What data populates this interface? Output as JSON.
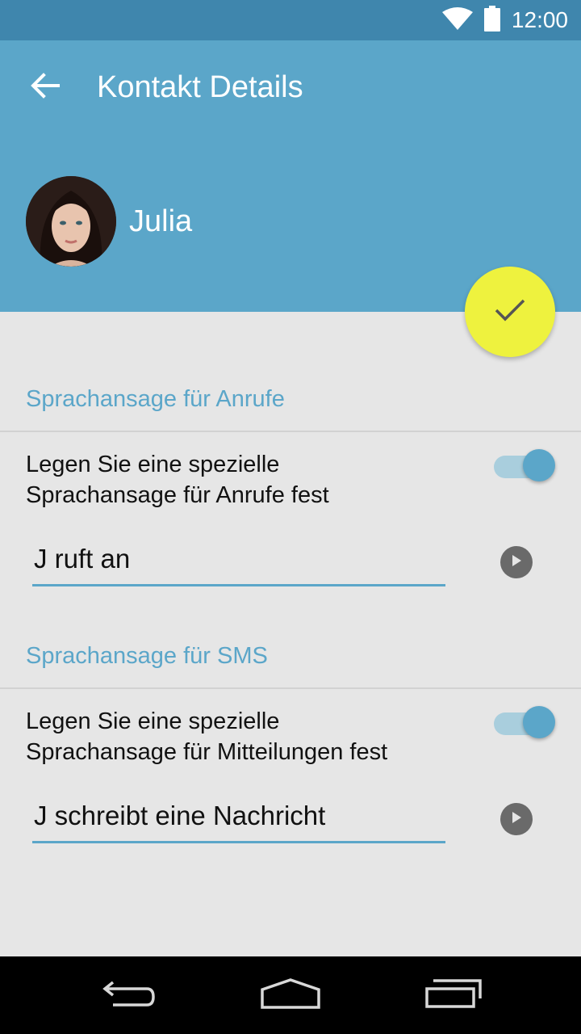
{
  "status_bar": {
    "time": "12:00",
    "icons": [
      "wifi-icon",
      "battery-icon"
    ]
  },
  "header": {
    "title": "Kontakt Details",
    "contact_name": "Julia",
    "back_icon": "arrow-left-icon"
  },
  "fab": {
    "icon": "check-icon",
    "color": "#eef23e"
  },
  "calls": {
    "section_title": "Sprachansage für Anrufe",
    "description_line1": "Legen Sie eine spezielle",
    "description_line2": "Sprachansage für Anrufe fest",
    "toggle_on": true,
    "announcement_value": "J ruft an"
  },
  "sms": {
    "section_title": "Sprachansage für SMS",
    "description_line1": "Legen Sie eine spezielle",
    "description_line2": "Sprachansage für Mitteilungen fest",
    "toggle_on": true,
    "announcement_value": "J schreibt eine Nachricht"
  },
  "nav_bar": {
    "buttons": [
      "back-icon",
      "home-icon",
      "recents-icon"
    ]
  },
  "colors": {
    "primary": "#5ba6c9",
    "primary_dark": "#3f86ad",
    "accent": "#eef23e",
    "background": "#e6e6e6"
  }
}
